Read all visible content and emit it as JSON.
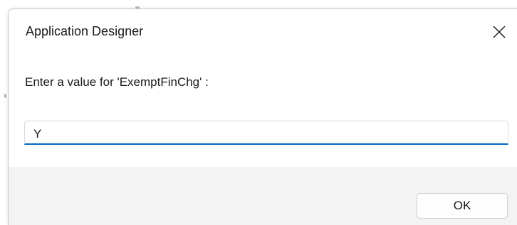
{
  "dialog": {
    "title": "Application Designer",
    "prompt": "Enter a value for 'ExemptFinChg' :",
    "input_value": "Y",
    "ok_label": "OK",
    "close_icon": "close-icon",
    "input_focus_color": "#0067c0"
  }
}
